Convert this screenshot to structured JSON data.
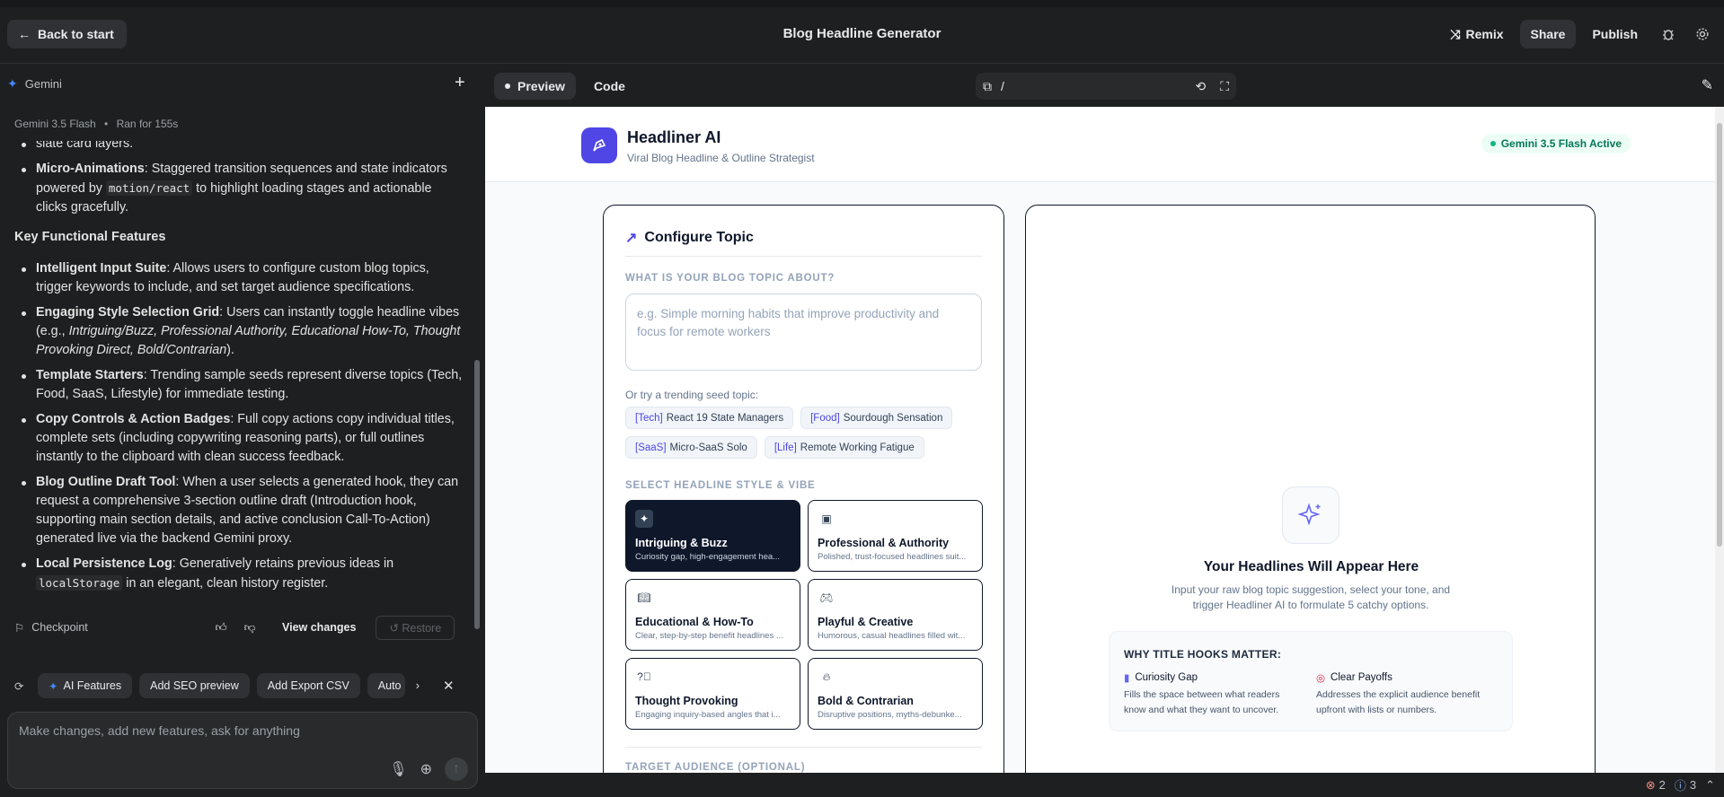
{
  "topbar": {
    "back_label": "Back to start",
    "title": "Blog Headline Generator",
    "remix_label": "Remix",
    "share_label": "Share",
    "publish_label": "Publish"
  },
  "left": {
    "model_label": "Gemini",
    "model_version": "Gemini 3.5 Flash",
    "separator": "•",
    "ran_for": "Ran for 155s",
    "partial_line": "slate card layers.",
    "anim_title": "Micro-Animations",
    "anim_text_1": ": Staggered transition sequences and state indicators powered by ",
    "anim_code": "motion/react",
    "anim_text_2": " to highlight loading stages and actionable clicks gracefully.",
    "features_heading": "Key Functional Features",
    "f1_title": "Intelligent Input Suite",
    "f1_text": ": Allows users to configure custom blog topics, trigger keywords to include, and set target audience specifications.",
    "f2_title": "Engaging Style Selection Grid",
    "f2_text": ": Users can instantly toggle headline vibes (e.g., ",
    "f2_italic": "Intriguing/Buzz, Professional Authority, Educational How-To, Thought Provoking Direct, Bold/Contrarian",
    "f2_end": ").",
    "f3_title": "Template Starters",
    "f3_text": ": Trending sample seeds represent diverse topics (Tech, Food, SaaS, Lifestyle) for immediate testing.",
    "f4_title": "Copy Controls & Action Badges",
    "f4_text": ": Full copy actions copy individual titles, complete sets (including copywriting reasoning parts), or full outlines instantly to the clipboard with clean success feedback.",
    "f5_title": "Blog Outline Draft Tool",
    "f5_text": ": When a user selects a generated hook, they can request a comprehensive 3-section outline draft (Introduction hook, supporting main section details, and active conclusion Call-To-Action) generated live via the backend Gemini proxy.",
    "f6_title": "Local Persistence Log",
    "f6_text": ": Generatively retains previous ideas in ",
    "f6_code": "localStorage",
    "f6_end": " in an elegant, clean history register.",
    "checkpoint_label": "Checkpoint",
    "view_changes_label": "View changes",
    "restore_label": "Restore",
    "chips": [
      "AI Features",
      "Add SEO preview",
      "Add Export CSV",
      "Auto"
    ],
    "prompt_placeholder": "Make changes, add new features, ask for anything"
  },
  "right": {
    "tab_preview": "Preview",
    "tab_code": "Code",
    "url_path": "/",
    "errors_count": "2",
    "info_count": "3"
  },
  "app": {
    "brand": "Headliner AI",
    "tagline": "Viral Blog Headline & Outline Strategist",
    "status": "Gemini 3.5 Flash Active",
    "configure_title": "Configure Topic",
    "topic_label": "WHAT IS YOUR BLOG TOPIC ABOUT?",
    "topic_placeholder": "e.g. Simple morning habits that improve productivity and focus for remote workers",
    "seed_label": "Or try a trending seed topic:",
    "seeds": [
      {
        "cat": "[Tech]",
        "text": "React 19 State Managers"
      },
      {
        "cat": "[Food]",
        "text": "Sourdough Sensation"
      },
      {
        "cat": "[SaaS]",
        "text": "Micro-SaaS Solo"
      },
      {
        "cat": "[Life]",
        "text": "Remote Working Fatigue"
      }
    ],
    "style_label": "SELECT HEADLINE STYLE & VIBE",
    "styles": [
      {
        "name": "Intriguing & Buzz",
        "desc": "Curiosity gap, high-engagement hea..."
      },
      {
        "name": "Professional & Authority",
        "desc": "Polished, trust-focused headlines suit..."
      },
      {
        "name": "Educational & How-To",
        "desc": "Clear, step-by-step benefit headlines ..."
      },
      {
        "name": "Playful & Creative",
        "desc": "Humorous, casual headlines filled wit..."
      },
      {
        "name": "Thought Provoking",
        "desc": "Engaging inquiry-based angles that i..."
      },
      {
        "name": "Bold & Contrarian",
        "desc": "Disruptive positions, myths-debunke..."
      }
    ],
    "audience_label": "TARGET AUDIENCE (OPTIONAL)",
    "empty_title": "Your Headlines Will Appear Here",
    "empty_sub": "Input your raw blog topic suggestion, select your tone, and trigger Headliner AI to formulate 5 catchy options.",
    "why_title": "WHY TITLE HOOKS MATTER:",
    "why1_title": "Curiosity Gap",
    "why1_text": "Fills the space between what readers know and what they want to uncover.",
    "why2_title": "Clear Payoffs",
    "why2_text": "Addresses the explicit audience benefit upfront with lists or numbers."
  }
}
